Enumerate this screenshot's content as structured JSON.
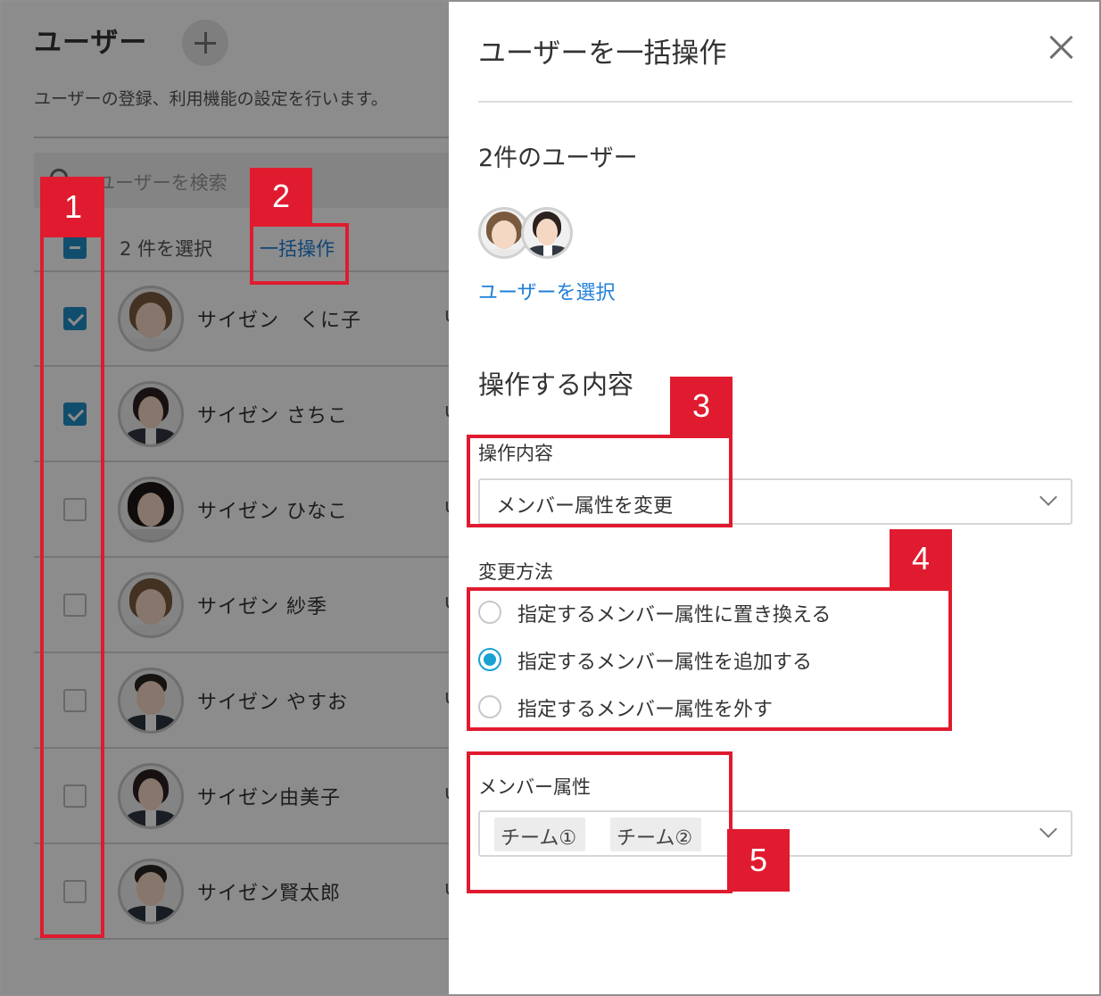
{
  "users_page": {
    "title": "ユーザー",
    "description": "ユーザーの登録、利用機能の設定を行います。",
    "search_placeholder": "ユーザーを検索",
    "selected_count": "2 件を選択",
    "bulk_action_link": "一括操作",
    "rows": [
      {
        "name": "サイゼン　くに子",
        "checked": true,
        "cut": "u"
      },
      {
        "name": "サイゼン さちこ",
        "checked": true,
        "cut": "u"
      },
      {
        "name": "サイゼン ひなこ",
        "checked": false,
        "cut": "u"
      },
      {
        "name": "サイゼン 紗季",
        "checked": false,
        "cut": "u"
      },
      {
        "name": "サイゼン やすお",
        "checked": false,
        "cut": "u"
      },
      {
        "name": "サイゼン由美子",
        "checked": false,
        "cut": "u"
      },
      {
        "name": "サイゼン賢太郎",
        "checked": false,
        "cut": "u"
      }
    ]
  },
  "panel": {
    "title": "ユーザーを一括操作",
    "selected_users_heading": "2件のユーザー",
    "select_users_link": "ユーザーを選択",
    "section_heading": "操作する内容",
    "operation_label": "操作内容",
    "operation_value": "メンバー属性を変更",
    "method_label": "変更方法",
    "methods": [
      {
        "label": "指定するメンバー属性に置き換える",
        "selected": false
      },
      {
        "label": "指定するメンバー属性を追加する",
        "selected": true
      },
      {
        "label": "指定するメンバー属性を外す",
        "selected": false
      }
    ],
    "attribute_label": "メンバー属性",
    "attribute_tags": [
      "チーム①",
      "チーム②"
    ]
  },
  "callouts": [
    "1",
    "2",
    "3",
    "4",
    "5"
  ],
  "colors": {
    "accent": "#1f8ec7",
    "link": "#1f7fd8",
    "radio": "#19a1d3",
    "callout": "#e01b2f"
  }
}
